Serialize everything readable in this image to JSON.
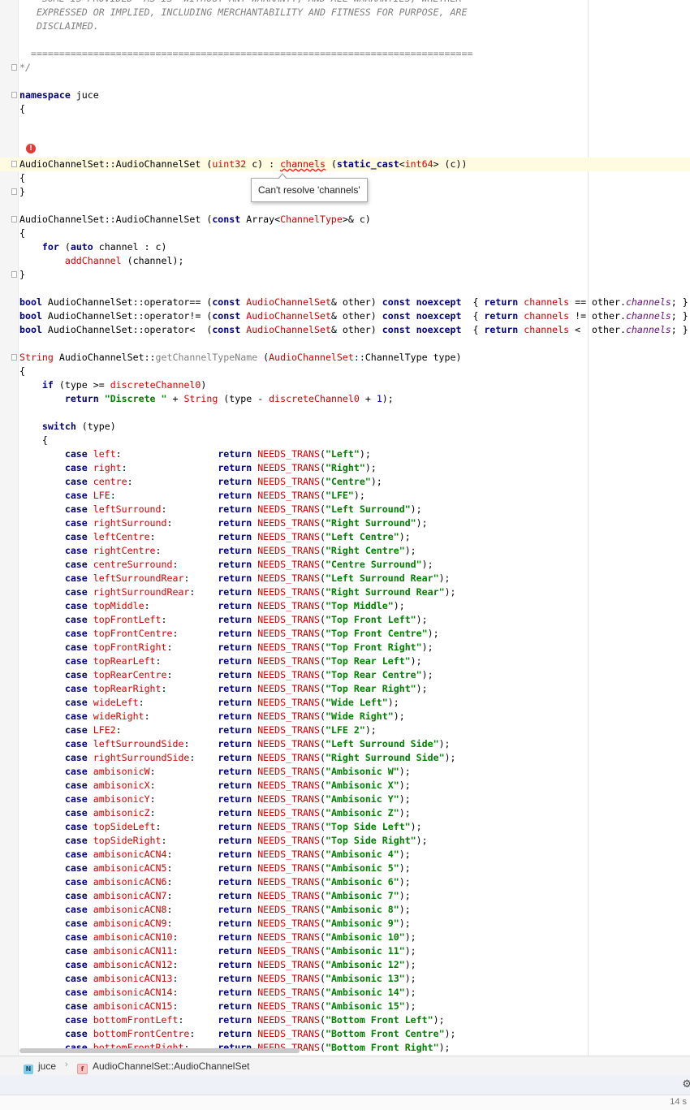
{
  "editor": {
    "lines": [
      {
        "segs": [
          [
            "    ",
            ""
          ],
          [
            "SOME IS PROVIDED \"AS IS\" WITHOUT ANY WARRANTY, AND ALL WARRANTIES, WHETHER",
            "t-com"
          ]
        ]
      },
      {
        "segs": [
          [
            "   EXPRESSED OR IMPLIED, INCLUDING MERCHANTABILITY AND FITNESS FOR PURPOSE, ARE",
            "t-com"
          ]
        ]
      },
      {
        "segs": [
          [
            "   DISCLAIMED.",
            "t-com"
          ]
        ]
      },
      {
        "segs": []
      },
      {
        "segs": [
          [
            "  ==============================================================================",
            "t-com"
          ]
        ]
      },
      {
        "segs": [
          [
            "*/",
            "t-com"
          ]
        ],
        "fold": true
      },
      {
        "segs": []
      },
      {
        "segs": [
          [
            "namespace",
            "t-kw"
          ],
          [
            " juce",
            ""
          ]
        ],
        "fold": true
      },
      {
        "segs": [
          [
            "{",
            ""
          ]
        ]
      },
      {
        "segs": []
      },
      {
        "segs": []
      },
      {
        "segs": []
      },
      {
        "segs": [
          [
            "AudioChannelSet::AudioChannelSet (",
            ""
          ],
          [
            "uint32",
            "t-type"
          ],
          [
            " c) : ",
            ""
          ],
          [
            "channels",
            "t-err"
          ],
          [
            " (",
            ""
          ],
          [
            "static_cast",
            "t-kw"
          ],
          [
            "<",
            ""
          ],
          [
            "int64",
            "t-type"
          ],
          [
            "> (c))",
            ""
          ]
        ],
        "fold": true,
        "current": true
      },
      {
        "segs": [
          [
            "{",
            ""
          ]
        ]
      },
      {
        "segs": [
          [
            "}",
            ""
          ]
        ],
        "fold": true
      },
      {
        "segs": []
      },
      {
        "segs": [
          [
            "AudioChannelSet::AudioChannelSet (",
            ""
          ],
          [
            "const",
            "t-kw"
          ],
          [
            " Array<",
            ""
          ],
          [
            "ChannelType",
            "t-type"
          ],
          [
            ">& c)",
            ""
          ]
        ],
        "fold": true
      },
      {
        "segs": [
          [
            "{",
            ""
          ]
        ]
      },
      {
        "segs": [
          [
            "    ",
            ""
          ],
          [
            "for",
            "t-kw"
          ],
          [
            " (",
            ""
          ],
          [
            "auto",
            "t-kw"
          ],
          [
            " channel : c)",
            ""
          ]
        ]
      },
      {
        "segs": [
          [
            "        ",
            ""
          ],
          [
            "addChannel",
            "t-mem"
          ],
          [
            " (channel);",
            ""
          ]
        ]
      },
      {
        "segs": [
          [
            "}",
            ""
          ]
        ],
        "fold": true
      },
      {
        "segs": []
      },
      {
        "segs": [
          [
            "bool",
            "t-kw"
          ],
          [
            " AudioChannelSet::operator== (",
            ""
          ],
          [
            "const",
            "t-kw"
          ],
          [
            " ",
            ""
          ],
          [
            "AudioChannelSet",
            "t-type"
          ],
          [
            "& other) ",
            ""
          ],
          [
            "const",
            "t-kw"
          ],
          [
            " ",
            ""
          ],
          [
            "noexcept",
            "t-kw"
          ],
          [
            "  { ",
            ""
          ],
          [
            "return",
            "t-kw"
          ],
          [
            " ",
            ""
          ],
          [
            "channels",
            "t-mem"
          ],
          [
            " == other.",
            ""
          ],
          [
            "channels",
            "t-member"
          ],
          [
            "; }",
            ""
          ]
        ]
      },
      {
        "segs": [
          [
            "bool",
            "t-kw"
          ],
          [
            " AudioChannelSet::operator!= (",
            ""
          ],
          [
            "const",
            "t-kw"
          ],
          [
            " ",
            ""
          ],
          [
            "AudioChannelSet",
            "t-type"
          ],
          [
            "& other) ",
            ""
          ],
          [
            "const",
            "t-kw"
          ],
          [
            " ",
            ""
          ],
          [
            "noexcept",
            "t-kw"
          ],
          [
            "  { ",
            ""
          ],
          [
            "return",
            "t-kw"
          ],
          [
            " ",
            ""
          ],
          [
            "channels",
            "t-mem"
          ],
          [
            " != other.",
            ""
          ],
          [
            "channels",
            "t-member"
          ],
          [
            "; }",
            ""
          ]
        ]
      },
      {
        "segs": [
          [
            "bool",
            "t-kw"
          ],
          [
            " AudioChannelSet::operator<  (",
            ""
          ],
          [
            "const",
            "t-kw"
          ],
          [
            " ",
            ""
          ],
          [
            "AudioChannelSet",
            "t-type"
          ],
          [
            "& other) ",
            ""
          ],
          [
            "const",
            "t-kw"
          ],
          [
            " ",
            ""
          ],
          [
            "noexcept",
            "t-kw"
          ],
          [
            "  { ",
            ""
          ],
          [
            "return",
            "t-kw"
          ],
          [
            " ",
            ""
          ],
          [
            "channels",
            "t-mem"
          ],
          [
            " <  other.",
            ""
          ],
          [
            "channels",
            "t-member"
          ],
          [
            "; }",
            ""
          ]
        ]
      },
      {
        "segs": []
      },
      {
        "segs": [
          [
            "String",
            "t-type"
          ],
          [
            " AudioChannelSet::",
            ""
          ],
          [
            "getChannelTypeName",
            "t-muted"
          ],
          [
            " (",
            ""
          ],
          [
            "AudioChannelSet",
            "t-type"
          ],
          [
            "::ChannelType type)",
            ""
          ]
        ],
        "fold": true
      },
      {
        "segs": [
          [
            "{",
            ""
          ]
        ]
      },
      {
        "segs": [
          [
            "    ",
            ""
          ],
          [
            "if",
            "t-kw"
          ],
          [
            " (type >= ",
            ""
          ],
          [
            "discreteChannel0",
            "t-mem"
          ],
          [
            ")",
            ""
          ]
        ]
      },
      {
        "segs": [
          [
            "        ",
            ""
          ],
          [
            "return",
            "t-kw"
          ],
          [
            " ",
            ""
          ],
          [
            "\"Discrete \"",
            "t-str"
          ],
          [
            " + ",
            ""
          ],
          [
            "String",
            "t-type"
          ],
          [
            " (type - ",
            ""
          ],
          [
            "discreteChannel0",
            "t-mem"
          ],
          [
            " + ",
            ""
          ],
          [
            "1",
            "t-num"
          ],
          [
            ");",
            ""
          ]
        ]
      },
      {
        "segs": []
      },
      {
        "segs": [
          [
            "    ",
            ""
          ],
          [
            "switch",
            "t-kw"
          ],
          [
            " (type)",
            ""
          ]
        ]
      },
      {
        "segs": [
          [
            "    {",
            ""
          ]
        ]
      }
    ],
    "cases": [
      [
        "left:                 ",
        "\"Left\""
      ],
      [
        "right:                ",
        "\"Right\""
      ],
      [
        "centre:               ",
        "\"Centre\""
      ],
      [
        "LFE:                  ",
        "\"LFE\""
      ],
      [
        "leftSurround:         ",
        "\"Left Surround\""
      ],
      [
        "rightSurround:        ",
        "\"Right Surround\""
      ],
      [
        "leftCentre:           ",
        "\"Left Centre\""
      ],
      [
        "rightCentre:          ",
        "\"Right Centre\""
      ],
      [
        "centreSurround:       ",
        "\"Centre Surround\""
      ],
      [
        "leftSurroundRear:     ",
        "\"Left Surround Rear\""
      ],
      [
        "rightSurroundRear:    ",
        "\"Right Surround Rear\""
      ],
      [
        "topMiddle:            ",
        "\"Top Middle\""
      ],
      [
        "topFrontLeft:         ",
        "\"Top Front Left\""
      ],
      [
        "topFrontCentre:       ",
        "\"Top Front Centre\""
      ],
      [
        "topFrontRight:        ",
        "\"Top Front Right\""
      ],
      [
        "topRearLeft:          ",
        "\"Top Rear Left\""
      ],
      [
        "topRearCentre:        ",
        "\"Top Rear Centre\""
      ],
      [
        "topRearRight:         ",
        "\"Top Rear Right\""
      ],
      [
        "wideLeft:             ",
        "\"Wide Left\""
      ],
      [
        "wideRight:            ",
        "\"Wide Right\""
      ],
      [
        "LFE2:                 ",
        "\"LFE 2\""
      ],
      [
        "leftSurroundSide:     ",
        "\"Left Surround Side\""
      ],
      [
        "rightSurroundSide:    ",
        "\"Right Surround Side\""
      ],
      [
        "ambisonicW:           ",
        "\"Ambisonic W\""
      ],
      [
        "ambisonicX:           ",
        "\"Ambisonic X\""
      ],
      [
        "ambisonicY:           ",
        "\"Ambisonic Y\""
      ],
      [
        "ambisonicZ:           ",
        "\"Ambisonic Z\""
      ],
      [
        "topSideLeft:          ",
        "\"Top Side Left\""
      ],
      [
        "topSideRight:         ",
        "\"Top Side Right\""
      ],
      [
        "ambisonicACN4:        ",
        "\"Ambisonic 4\""
      ],
      [
        "ambisonicACN5:        ",
        "\"Ambisonic 5\""
      ],
      [
        "ambisonicACN6:        ",
        "\"Ambisonic 6\""
      ],
      [
        "ambisonicACN7:        ",
        "\"Ambisonic 7\""
      ],
      [
        "ambisonicACN8:        ",
        "\"Ambisonic 8\""
      ],
      [
        "ambisonicACN9:        ",
        "\"Ambisonic 9\""
      ],
      [
        "ambisonicACN10:       ",
        "\"Ambisonic 10\""
      ],
      [
        "ambisonicACN11:       ",
        "\"Ambisonic 11\""
      ],
      [
        "ambisonicACN12:       ",
        "\"Ambisonic 12\""
      ],
      [
        "ambisonicACN13:       ",
        "\"Ambisonic 13\""
      ],
      [
        "ambisonicACN14:       ",
        "\"Ambisonic 14\""
      ],
      [
        "ambisonicACN15:       ",
        "\"Ambisonic 15\""
      ],
      [
        "bottomFrontLeft:      ",
        "\"Bottom Front Left\""
      ],
      [
        "bottomFrontCentre:    ",
        "\"Bottom Front Centre\""
      ],
      [
        "bottomFrontRight:     ",
        "\"Bottom Front Right\""
      ]
    ],
    "case_keyword": "case",
    "return_keyword": "return",
    "macro_name": "NEEDS_TRANS"
  },
  "error_icon": "error-bulb-icon",
  "tooltip": {
    "text": "Can't resolve 'channels'"
  },
  "breadcrumb": {
    "namespace_icon_letter": "N",
    "namespace": "juce",
    "separator": "›",
    "function_icon_letter": "f",
    "function": "AudioChannelSet::AudioChannelSet"
  },
  "status": {
    "time": "14 s",
    "gear_icon": "gear-icon"
  },
  "colors": {
    "keyword": "#000080",
    "string": "#008000",
    "member": "#d50000",
    "current_line": "#fffbe0",
    "error": "#e53935"
  }
}
